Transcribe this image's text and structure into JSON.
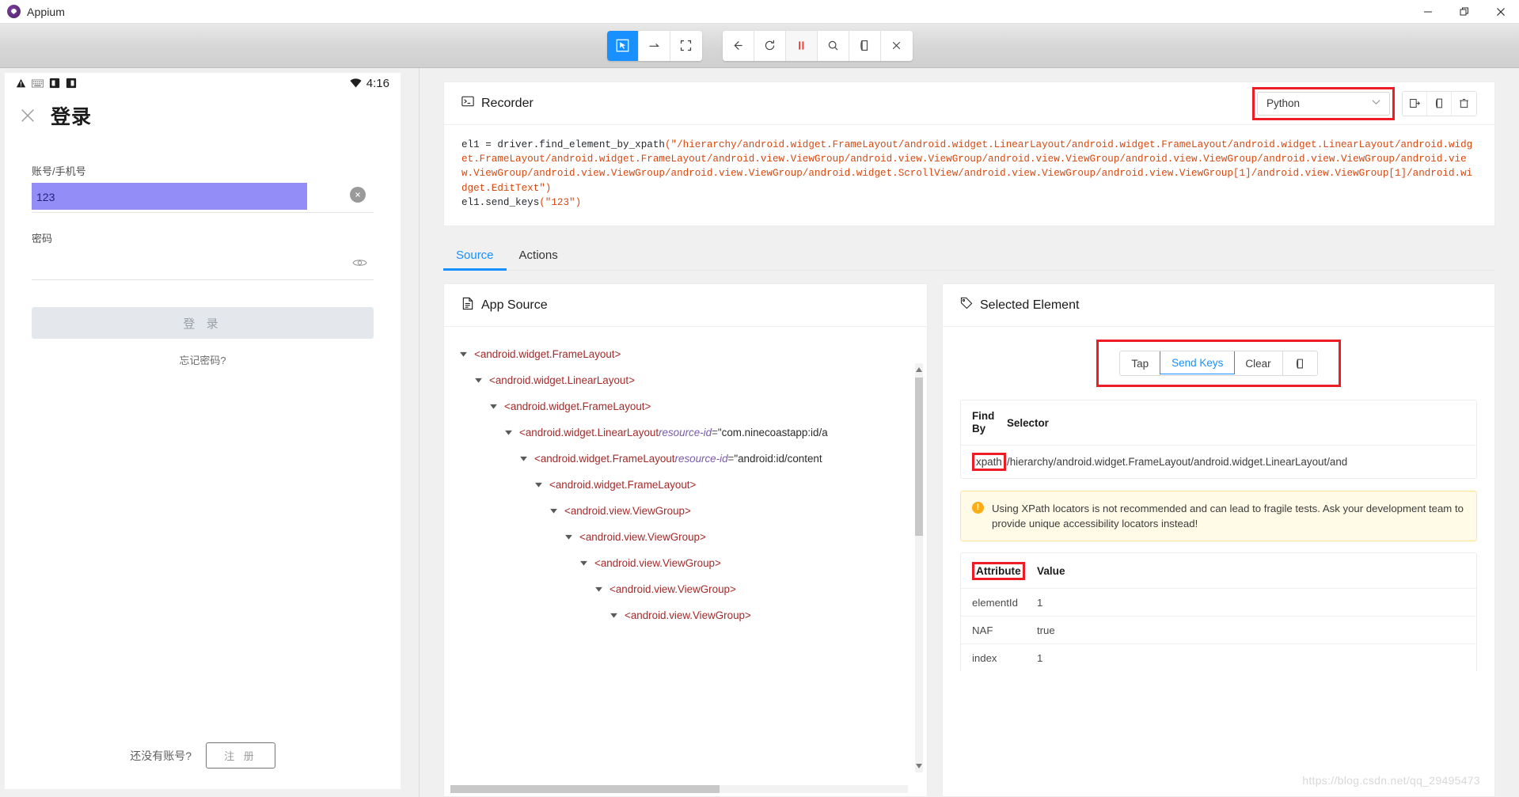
{
  "window": {
    "title": "Appium",
    "logo_icon": "appium-logo-icon",
    "minimize_label": "—",
    "maximize_label": "❐",
    "close_label": "✕"
  },
  "toolbar": {
    "left_group": [
      {
        "name": "select-element-tool",
        "icon": "cursor-select-icon",
        "active": true
      },
      {
        "name": "swipe-tool",
        "icon": "arrow-right-icon",
        "active": false
      },
      {
        "name": "tap-by-coordinates-tool",
        "icon": "crosshair-frame-icon",
        "active": false
      }
    ],
    "right_group": [
      {
        "name": "back-button",
        "icon": "arrow-left-icon"
      },
      {
        "name": "refresh-button",
        "icon": "refresh-icon"
      },
      {
        "name": "pause-recording-button",
        "icon": "pause-icon"
      },
      {
        "name": "search-button",
        "icon": "search-icon"
      },
      {
        "name": "copy-button",
        "icon": "copy-icon"
      },
      {
        "name": "quit-session-button",
        "icon": "close-x-icon"
      }
    ]
  },
  "device": {
    "status_bar": {
      "icons": [
        "warning-triangle-icon",
        "keyboard-icon",
        "screen-rotate-icon",
        "screen-cast-icon"
      ],
      "wifi_icon": "wifi-icon",
      "time": "4:16"
    },
    "nav": {
      "close_icon": "close-x-icon",
      "title": "登录"
    },
    "account_field": {
      "label": "账号/手机号",
      "value": "123",
      "clear_icon": "clear-circle-icon"
    },
    "password_field": {
      "label": "密码",
      "value": "",
      "eye_icon": "eye-icon"
    },
    "login_button": "登  录",
    "forgot_password": "忘记密码?",
    "register_prompt": "还没有账号?",
    "register_button": "注  册"
  },
  "recorder": {
    "title": "Recorder",
    "title_icon": "terminal-icon",
    "language": "Python",
    "language_chevron": "chevron-down-icon",
    "actions": [
      {
        "name": "show-boilerplate-button",
        "icon": "boilerplate-icon"
      },
      {
        "name": "copy-code-button",
        "icon": "copy-icon"
      },
      {
        "name": "clear-recorder-button",
        "icon": "trash-icon"
      }
    ],
    "code_line1_prefix": "el1 = driver.find_element_by_xpath",
    "code_line1_arg": "(\"/hierarchy/android.widget.FrameLayout/android.widget.LinearLayout/android.widget.FrameLayout/android.widget.LinearLayout/android.widget.FrameLayout/android.widget.FrameLayout/android.view.ViewGroup/android.view.ViewGroup/android.view.ViewGroup/android.view.ViewGroup/android.view.ViewGroup/android.view.ViewGroup/android.view.ViewGroup/android.view.ViewGroup/android.widget.ScrollView/android.view.ViewGroup/android.view.ViewGroup[1]/android.view.ViewGroup[1]/android.widget.EditText\")",
    "code_line2_prefix": "el1.send_keys",
    "code_line2_arg": "(\"123\")"
  },
  "tabs": [
    {
      "label": "Source",
      "active": true
    },
    {
      "label": "Actions",
      "active": false
    }
  ],
  "app_source": {
    "title": "App Source",
    "title_icon": "document-icon",
    "rows": [
      {
        "indent": 0,
        "tag": "<android.widget.FrameLayout>",
        "attr": "",
        "attr_value": ""
      },
      {
        "indent": 1,
        "tag": "<android.widget.LinearLayout>",
        "attr": "",
        "attr_value": ""
      },
      {
        "indent": 2,
        "tag": "<android.widget.FrameLayout>",
        "attr": "",
        "attr_value": ""
      },
      {
        "indent": 3,
        "tag": "<android.widget.LinearLayout",
        "attr": "resource-id",
        "attr_value": "\"com.ninecoastapp:id/a"
      },
      {
        "indent": 4,
        "tag": "<android.widget.FrameLayout",
        "attr": "resource-id",
        "attr_value": "\"android:id/content"
      },
      {
        "indent": 5,
        "tag": "<android.widget.FrameLayout>",
        "attr": "",
        "attr_value": ""
      },
      {
        "indent": 6,
        "tag": "<android.view.ViewGroup>",
        "attr": "",
        "attr_value": ""
      },
      {
        "indent": 7,
        "tag": "<android.view.ViewGroup>",
        "attr": "",
        "attr_value": ""
      },
      {
        "indent": 8,
        "tag": "<android.view.ViewGroup>",
        "attr": "",
        "attr_value": ""
      },
      {
        "indent": 9,
        "tag": "<android.view.ViewGroup>",
        "attr": "",
        "attr_value": ""
      },
      {
        "indent": 10,
        "tag": "<android.view.ViewGroup>",
        "attr": "",
        "attr_value": ""
      }
    ],
    "scroll_up_icon": "scroll-up-arrow-icon",
    "scroll_down_icon": "scroll-down-arrow-icon"
  },
  "selected_element": {
    "title": "Selected Element",
    "title_icon": "tag-icon",
    "actions": [
      {
        "label": "Tap",
        "active": false
      },
      {
        "label": "Send Keys",
        "active": true
      },
      {
        "label": "Clear",
        "active": false
      }
    ],
    "copy_icon": "copy-icon",
    "selector_table": {
      "headers": [
        "Find By",
        "Selector"
      ],
      "rows": [
        {
          "find_by": "xpath",
          "selector": "/hierarchy/android.widget.FrameLayout/android.widget.LinearLayout/and"
        }
      ]
    },
    "warning": {
      "icon": "warning-exclamation-icon",
      "text": "Using XPath locators is not recommended and can lead to fragile tests. Ask your development team to provide unique accessibility locators instead!"
    },
    "attribute_table": {
      "headers": [
        "Attribute",
        "Value"
      ],
      "rows": [
        {
          "attribute": "elementId",
          "value": "1"
        },
        {
          "attribute": "NAF",
          "value": "true"
        },
        {
          "attribute": "index",
          "value": "1"
        }
      ]
    }
  },
  "watermark": "https://blog.csdn.net/qq_29495473",
  "colors": {
    "accent_blue": "#1890ff",
    "highlight_red": "#ee1c25",
    "code_orange": "#d9480f",
    "field_purple": "#7b74f7",
    "warn_bg": "#fffbe6"
  }
}
